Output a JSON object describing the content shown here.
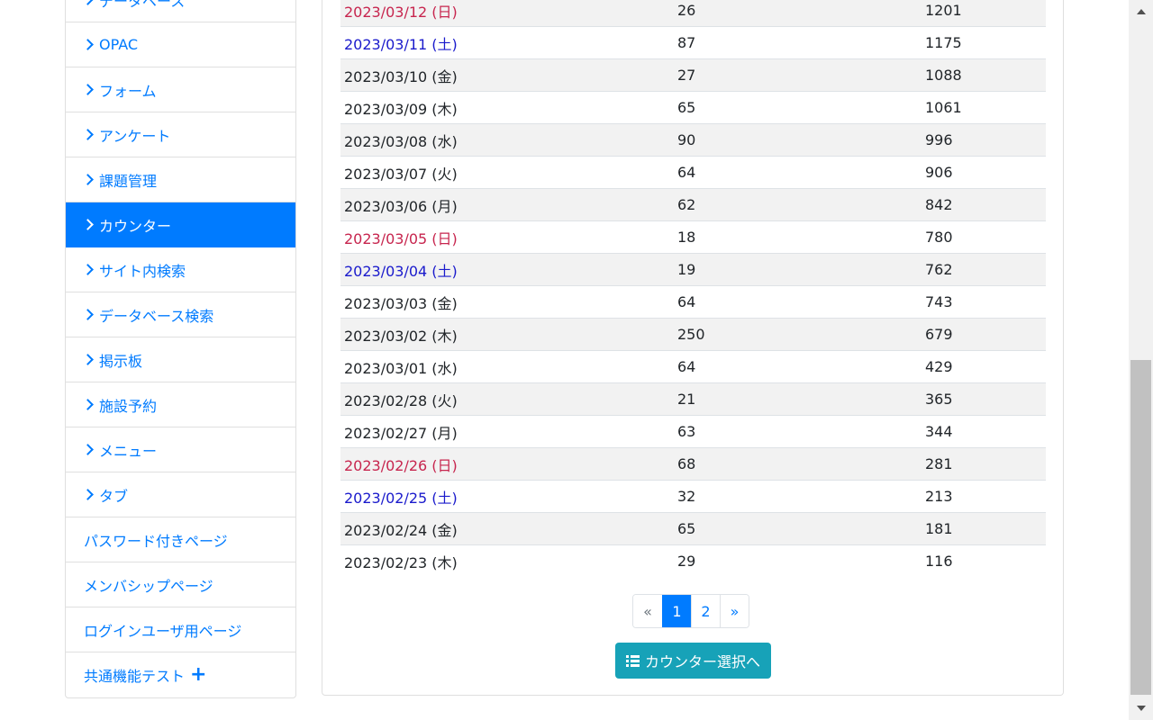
{
  "sidebar": {
    "items": [
      {
        "label": "データベース",
        "chevron": true
      },
      {
        "label": "OPAC",
        "chevron": true
      },
      {
        "label": "フォーム",
        "chevron": true
      },
      {
        "label": "アンケート",
        "chevron": true
      },
      {
        "label": "課題管理",
        "chevron": true
      },
      {
        "label": "カウンター",
        "chevron": true,
        "active": true
      },
      {
        "label": "サイト内検索",
        "chevron": true
      },
      {
        "label": "データベース検索",
        "chevron": true
      },
      {
        "label": "掲示板",
        "chevron": true
      },
      {
        "label": "施設予約",
        "chevron": true
      },
      {
        "label": "メニュー",
        "chevron": true
      },
      {
        "label": "タブ",
        "chevron": true
      },
      {
        "label": "パスワード付きページ",
        "chevron": false
      },
      {
        "label": "メンバシップページ",
        "chevron": false
      },
      {
        "label": "ログインユーザ用ページ",
        "chevron": false
      },
      {
        "label": "共通機能テスト",
        "chevron": false,
        "plus": true
      }
    ]
  },
  "table": {
    "rows": [
      {
        "date": "2023/03/12 (日)",
        "daily": "26",
        "total": "1201",
        "day_type": "sun"
      },
      {
        "date": "2023/03/11 (土)",
        "daily": "87",
        "total": "1175",
        "day_type": "sat"
      },
      {
        "date": "2023/03/10 (金)",
        "daily": "27",
        "total": "1088",
        "day_type": "weekday"
      },
      {
        "date": "2023/03/09 (木)",
        "daily": "65",
        "total": "1061",
        "day_type": "weekday"
      },
      {
        "date": "2023/03/08 (水)",
        "daily": "90",
        "total": "996",
        "day_type": "weekday"
      },
      {
        "date": "2023/03/07 (火)",
        "daily": "64",
        "total": "906",
        "day_type": "weekday"
      },
      {
        "date": "2023/03/06 (月)",
        "daily": "62",
        "total": "842",
        "day_type": "weekday"
      },
      {
        "date": "2023/03/05 (日)",
        "daily": "18",
        "total": "780",
        "day_type": "sun"
      },
      {
        "date": "2023/03/04 (土)",
        "daily": "19",
        "total": "762",
        "day_type": "sat"
      },
      {
        "date": "2023/03/03 (金)",
        "daily": "64",
        "total": "743",
        "day_type": "weekday"
      },
      {
        "date": "2023/03/02 (木)",
        "daily": "250",
        "total": "679",
        "day_type": "weekday"
      },
      {
        "date": "2023/03/01 (水)",
        "daily": "64",
        "total": "429",
        "day_type": "weekday"
      },
      {
        "date": "2023/02/28 (火)",
        "daily": "21",
        "total": "365",
        "day_type": "weekday"
      },
      {
        "date": "2023/02/27 (月)",
        "daily": "63",
        "total": "344",
        "day_type": "weekday"
      },
      {
        "date": "2023/02/26 (日)",
        "daily": "68",
        "total": "281",
        "day_type": "sun"
      },
      {
        "date": "2023/02/25 (土)",
        "daily": "32",
        "total": "213",
        "day_type": "sat"
      },
      {
        "date": "2023/02/24 (金)",
        "daily": "65",
        "total": "181",
        "day_type": "weekday"
      },
      {
        "date": "2023/02/23 (木)",
        "daily": "29",
        "total": "116",
        "day_type": "weekday"
      }
    ]
  },
  "pagination": {
    "prev": "«",
    "pages": [
      "1",
      "2"
    ],
    "current": "1",
    "next": "»"
  },
  "counter_button": {
    "label": "カウンター選択へ",
    "icon": "list-icon"
  },
  "colors": {
    "accent": "#007bff",
    "sunday": "#c7254e",
    "saturday": "#1a1acc",
    "button": "#17a2b8",
    "stripe": "#f2f2f2"
  }
}
